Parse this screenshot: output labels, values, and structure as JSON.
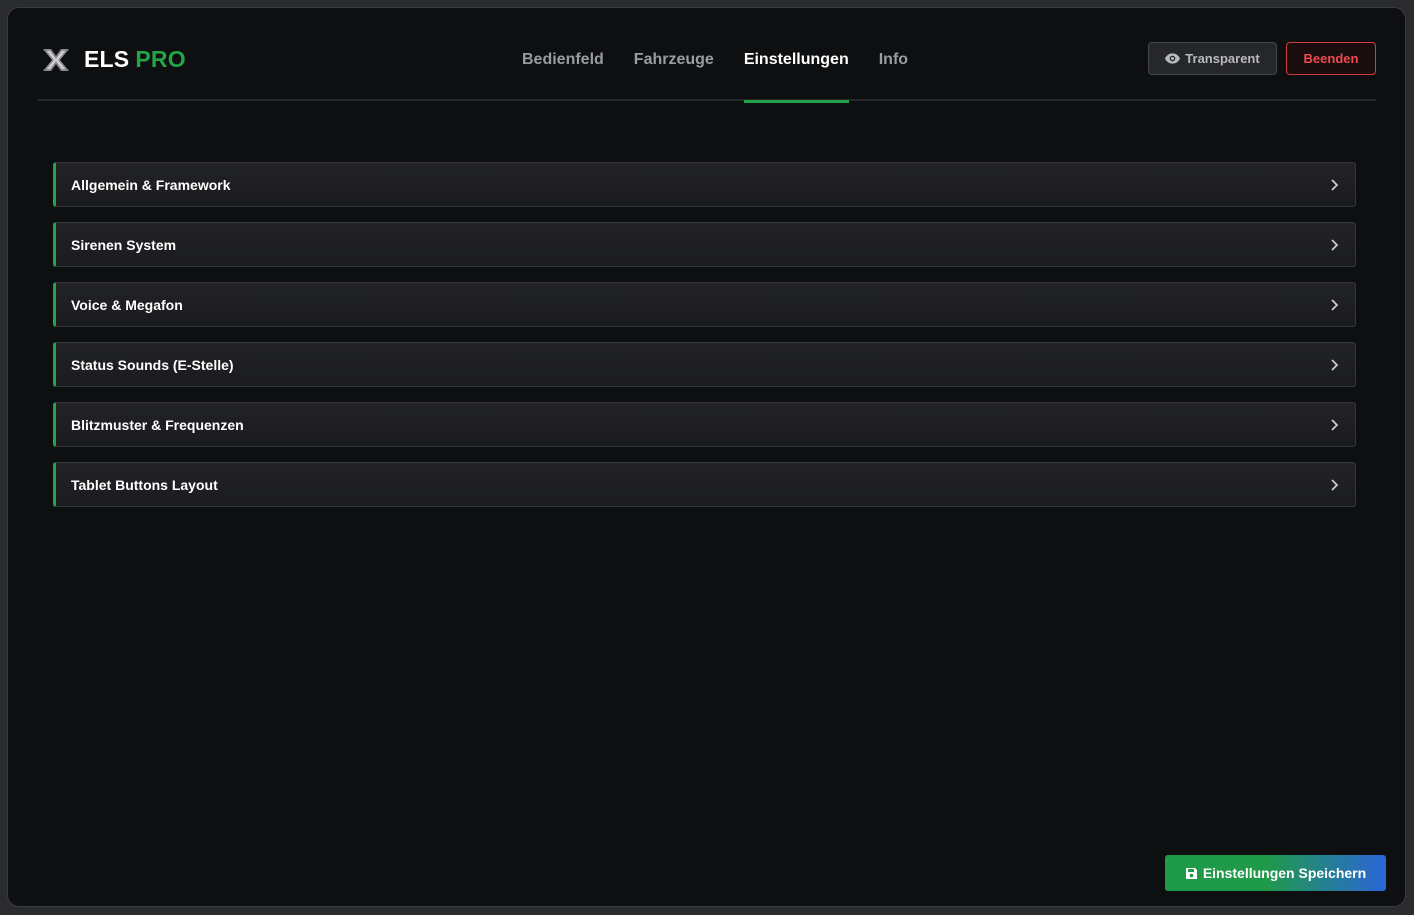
{
  "brand": {
    "logo_icon": "x-logo-icon",
    "name": "ELS",
    "accent": "PRO",
    "accent_color": "#22a447"
  },
  "nav": {
    "tabs": [
      {
        "label": "Bedienfeld",
        "active": false
      },
      {
        "label": "Fahrzeuge",
        "active": false
      },
      {
        "label": "Einstellungen",
        "active": true
      },
      {
        "label": "Info",
        "active": false
      }
    ]
  },
  "actions": {
    "transparent_label": "Transparent",
    "transparent_icon": "eye-icon",
    "quit_label": "Beenden",
    "quit_color": "#f04a50"
  },
  "sections": [
    {
      "label": "Allgemein & Framework"
    },
    {
      "label": "Sirenen System"
    },
    {
      "label": "Voice & Megafon"
    },
    {
      "label": "Status Sounds (E-Stelle)"
    },
    {
      "label": "Blitzmuster & Frequenzen"
    },
    {
      "label": "Tablet Buttons Layout"
    }
  ],
  "footer": {
    "save_label": "Einstellungen Speichern",
    "save_icon": "save-icon"
  }
}
